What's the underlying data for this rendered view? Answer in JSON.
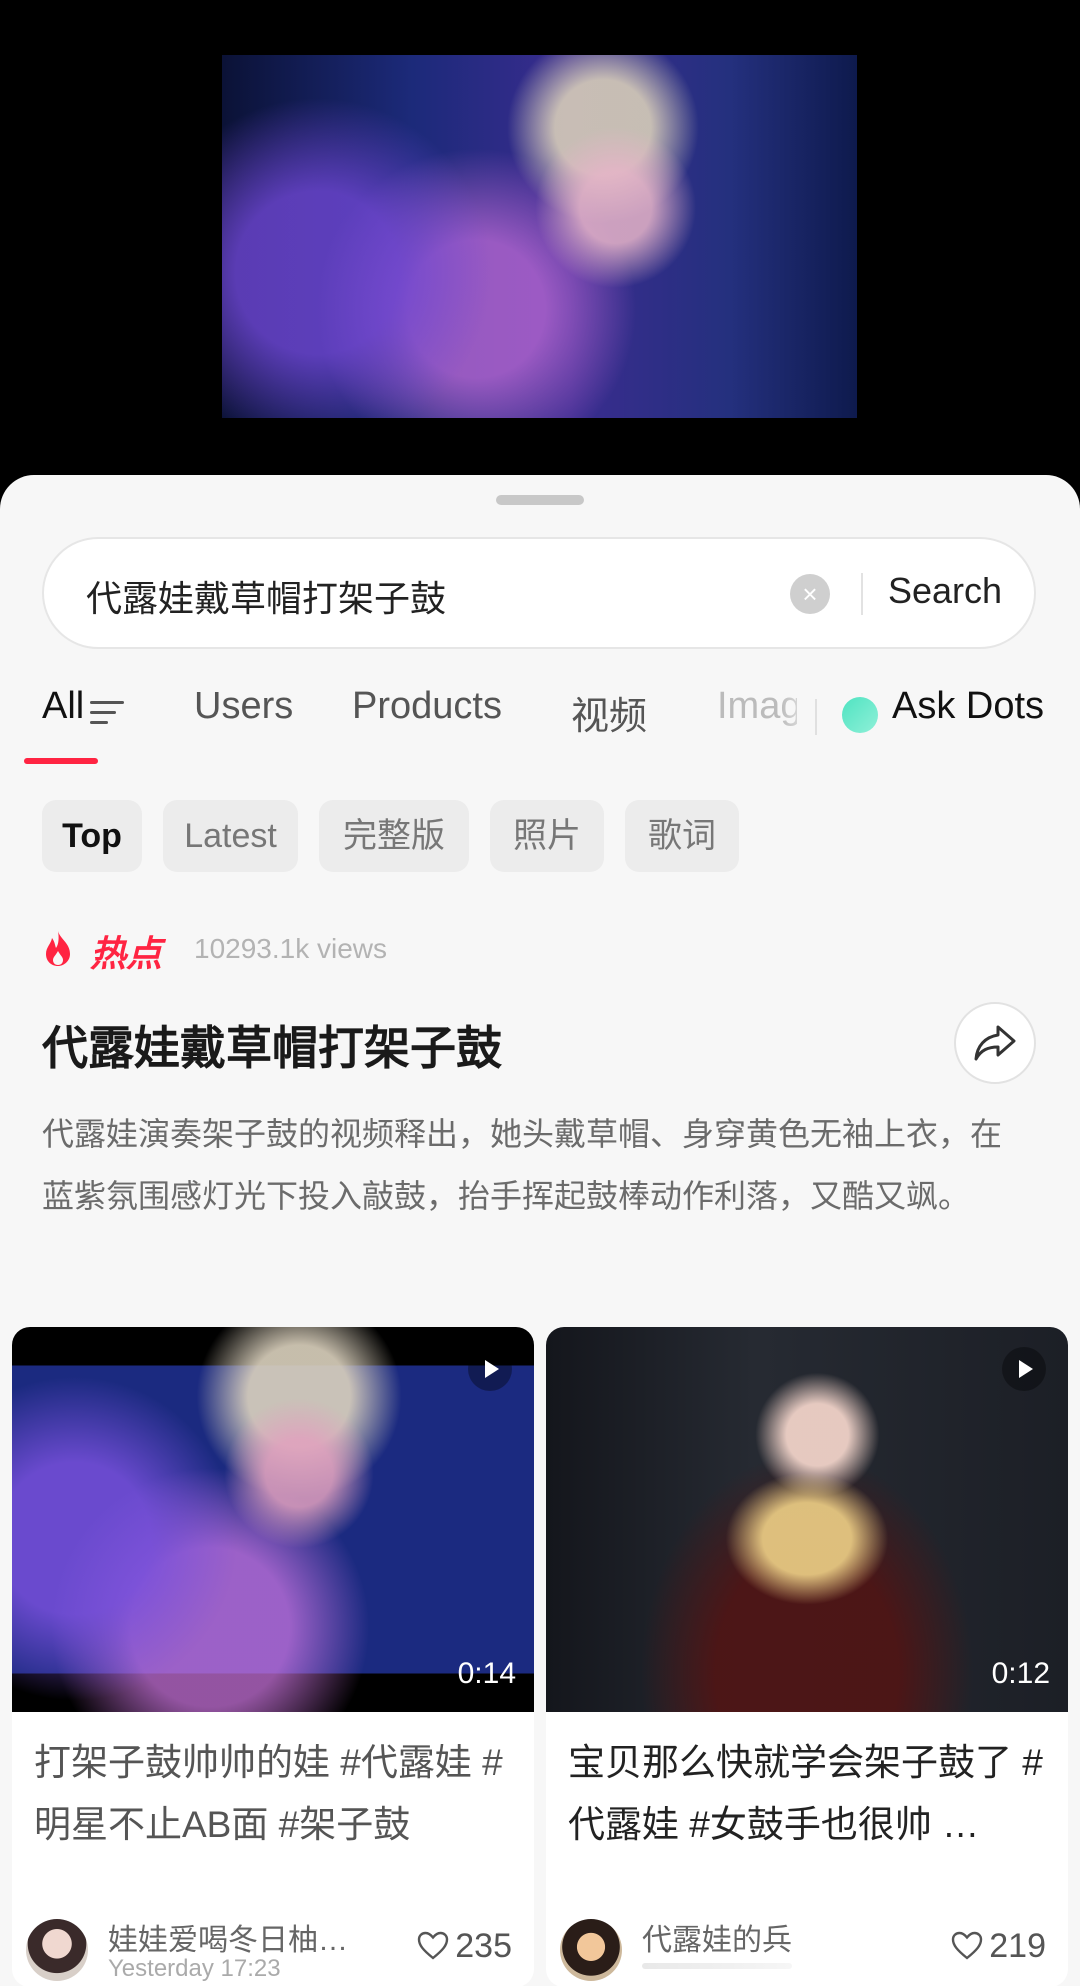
{
  "search": {
    "query": "代露娃戴草帽打架子鼓",
    "clear_icon": "clear-icon",
    "button_label": "Search"
  },
  "tabs": [
    {
      "label": "All",
      "active": true
    },
    {
      "label": "Users"
    },
    {
      "label": "Products"
    },
    {
      "label": "视频"
    },
    {
      "label": "Images"
    },
    {
      "label": "Ask Dots"
    }
  ],
  "chips": [
    {
      "label": "Top",
      "active": true
    },
    {
      "label": "Latest"
    },
    {
      "label": "完整版"
    },
    {
      "label": "照片"
    },
    {
      "label": "歌词"
    }
  ],
  "hot": {
    "label": "热点",
    "views": "10293.1k views",
    "title": "代露娃戴草帽打架子鼓",
    "description": "代露娃演奏架子鼓的视频释出，她头戴草帽、身穿黄色无袖上衣，在蓝紫氛围感灯光下投入敲鼓，抬手挥起鼓棒动作利落，又酷又飒。"
  },
  "cards": [
    {
      "duration": "0:14",
      "title": "打架子鼓帅帅的娃 #代露娃 #明星不止AB面 #架子鼓",
      "author": "娃娃爱喝冬日柚…",
      "time": "Yesterday 17:23",
      "likes": "235"
    },
    {
      "duration": "0:12",
      "title": "宝贝那么快就学会架子鼓了 #代露娃 #女鼓手也很帅 …",
      "author": "代露娃的兵",
      "likes": "219"
    }
  ],
  "colors": {
    "accent": "#ff2442",
    "sheet_bg": "#f7f7f7",
    "ask_dots": "#4fe3c1"
  }
}
